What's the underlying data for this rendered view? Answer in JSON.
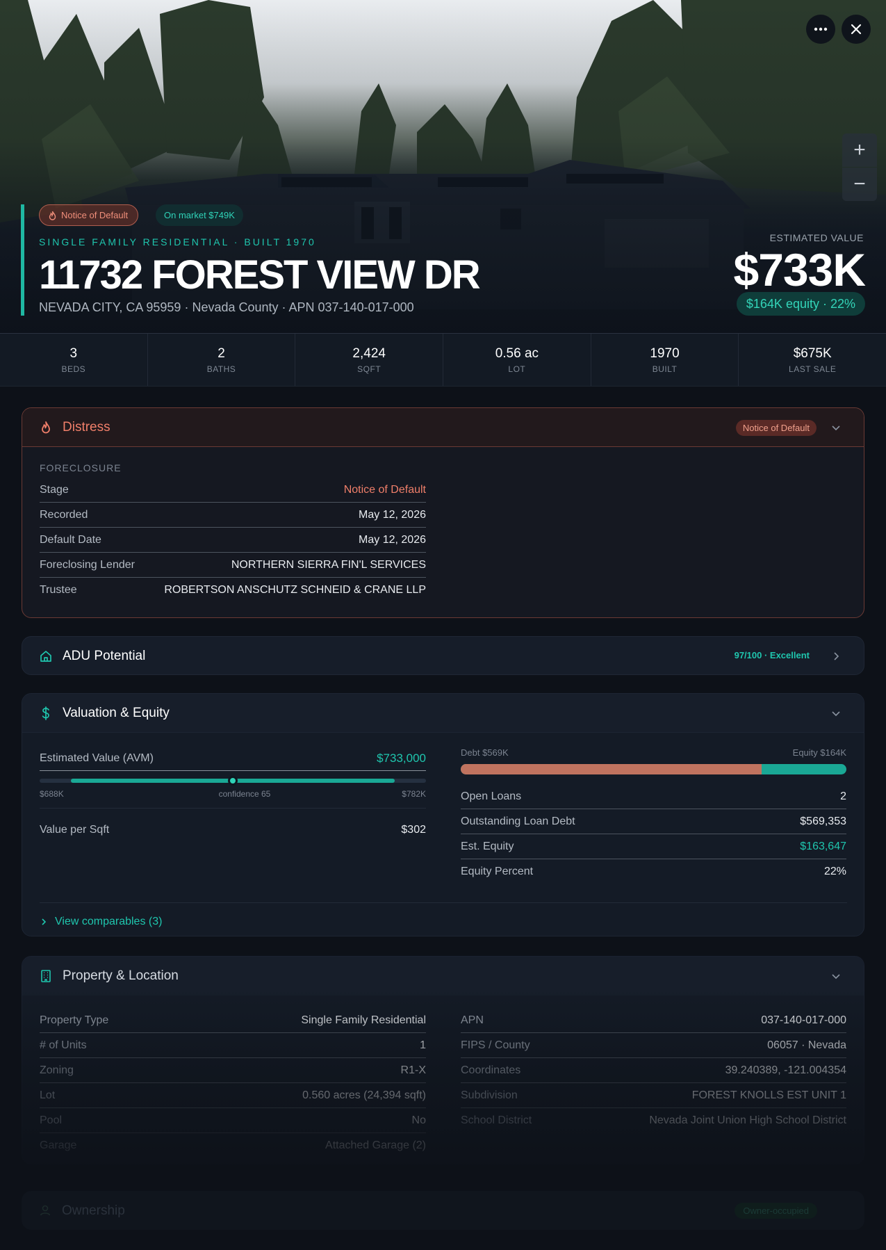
{
  "hero": {
    "badge_distress": "Notice of Default",
    "badge_market": "On market $749K",
    "subtitle": "SINGLE FAMILY RESIDENTIAL · BUILT 1970",
    "address": "11732 FOREST VIEW DR",
    "location": "NEVADA CITY, CA 95959 · Nevada County · APN 037-140-017-000",
    "estimated_label": "ESTIMATED VALUE",
    "estimated_value": "$733K",
    "equity_pill": "$164K equity · 22%",
    "more_icon": "more-dots-icon",
    "close_icon": "close-icon",
    "zoom_in": "+",
    "zoom_out": "−"
  },
  "stats": [
    {
      "value": "3",
      "label": "BEDS"
    },
    {
      "value": "2",
      "label": "BATHS"
    },
    {
      "value": "2,424",
      "label": "SQFT"
    },
    {
      "value": "0.56 ac",
      "label": "LOT"
    },
    {
      "value": "1970",
      "label": "BUILT"
    },
    {
      "value": "$675K",
      "label": "LAST SALE"
    }
  ],
  "distress": {
    "title": "Distress",
    "chip": "Notice of Default",
    "section_label": "FORECLOSURE",
    "rows": [
      {
        "key": "Stage",
        "value": "Notice of Default"
      },
      {
        "key": "Recorded",
        "value": "May 12, 2026"
      },
      {
        "key": "Default Date",
        "value": "May 12, 2026"
      },
      {
        "key": "Foreclosing Lender",
        "value": "NORTHERN SIERRA FIN'L SERVICES"
      },
      {
        "key": "Trustee",
        "value": "ROBERTSON ANSCHUTZ SCHNEID & CRANE LLP"
      }
    ],
    "stage_color": "#f07f6a"
  },
  "adu": {
    "title": "ADU Potential",
    "score": "97/100 · Excellent"
  },
  "valuation": {
    "title": "Valuation & Equity",
    "avm_label": "Estimated Value (AVM)",
    "avm_value": "$733,000",
    "range_low": "$688K",
    "range_high": "$782K",
    "confidence": "confidence 65",
    "avm_position_fraction": 0.5,
    "per_sqft_label": "Value per Sqft",
    "per_sqft_value": "$302",
    "debt_label": "Debt $569K",
    "equity_label": "Equity $164K",
    "debt_fraction": 0.78,
    "rows": [
      {
        "key": "Open Loans",
        "value": "2"
      },
      {
        "key": "Outstanding Loan Debt",
        "value": "$569,353"
      },
      {
        "key": "Est. Equity",
        "value": "$163,647"
      },
      {
        "key": "Equity Percent",
        "value": "22%"
      }
    ],
    "comparables": "View comparables (3)"
  },
  "property": {
    "title": "Property & Location",
    "left": [
      {
        "key": "Property Type",
        "value": "Single Family Residential"
      },
      {
        "key": "# of Units",
        "value": "1"
      },
      {
        "key": "Zoning",
        "value": "R1-X"
      },
      {
        "key": "Lot",
        "value": "0.560 acres (24,394 sqft)"
      },
      {
        "key": "Pool",
        "value": "No"
      },
      {
        "key": "Garage",
        "value": "Attached Garage (2)"
      }
    ],
    "right": [
      {
        "key": "APN",
        "value": "037-140-017-000"
      },
      {
        "key": "FIPS / County",
        "value": "06057 · Nevada"
      },
      {
        "key": "Coordinates",
        "value": "39.240389, -121.004354"
      },
      {
        "key": "Subdivision",
        "value": "FOREST KNOLLS EST UNIT 1"
      },
      {
        "key": "School District",
        "value": "Nevada Joint Union High School District"
      }
    ]
  },
  "ownership": {
    "title": "Ownership",
    "chip": "Owner-occupied"
  },
  "colors": {
    "accent": "#1fc6ae",
    "distress": "#f07f6a",
    "debt": "#c0735f"
  }
}
